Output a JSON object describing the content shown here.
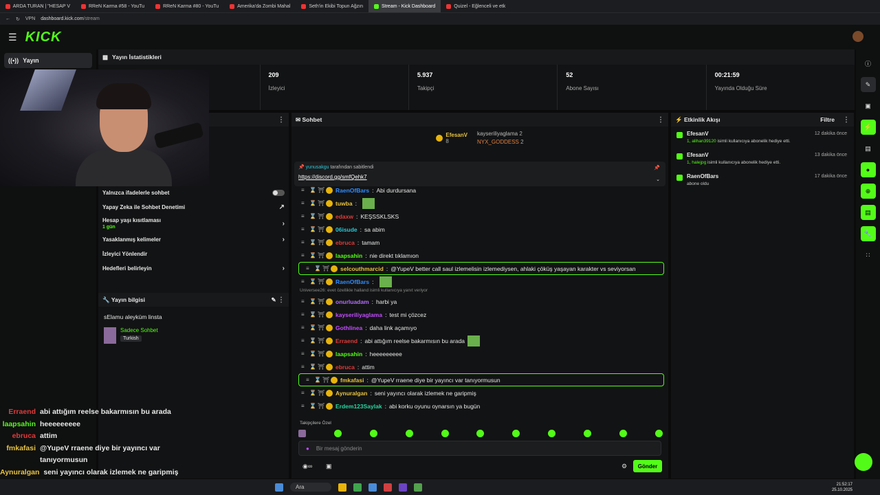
{
  "browser": {
    "tabs": [
      {
        "label": "ARDA TURAN | \"HESAP V"
      },
      {
        "label": "RReN Karma #58 - YouTu"
      },
      {
        "label": "RReN Karma #80 - YouTu"
      },
      {
        "label": "Amerika'da Zombi Mahal"
      },
      {
        "label": "Seth'in Ekibi Topun Ağzın"
      },
      {
        "label": "Stream - Kick Dashboard",
        "active": true
      },
      {
        "label": "Quizel - Eğlenceli ve etk"
      }
    ],
    "vpn": "VPN",
    "url_domain": "dashboard.kick.com",
    "url_path": "/stream"
  },
  "app": {
    "logo": "KICK"
  },
  "leftnav": {
    "items": [
      {
        "label": "Yayın"
      }
    ]
  },
  "stats": {
    "title": "Yayın İstatistikleri",
    "items": [
      {
        "value": "209",
        "label": "İzleyici"
      },
      {
        "value": "5.937",
        "label": "Takipçi"
      },
      {
        "value": "52",
        "label": "Abone Sayısı"
      },
      {
        "value": "00:21:59",
        "label": "Yayında Olduğu Süre"
      }
    ]
  },
  "settings": {
    "rows": [
      {
        "label": "Yalnızca ifadelerle sohbet",
        "control": "toggle"
      },
      {
        "label": "Yapay Zeka ile Sohbet Denetimi",
        "control": "link"
      },
      {
        "label": "Hesap yaşı kısıtlaması",
        "sub": "1 gün",
        "control": "chevron"
      },
      {
        "label": "Yasaklanmış kelimeler",
        "control": "chevron"
      },
      {
        "label": "İzleyici Yönlendir",
        "control": "none"
      },
      {
        "label": "Hedefleri belirleyin",
        "control": "chevron"
      }
    ]
  },
  "streaminfo": {
    "title": "Yayın bilgisi",
    "stream_title": "sElamu aleyküm linsta",
    "category": "Sadece Sohbet",
    "language": "Turkish"
  },
  "chat": {
    "title": "Sohbet",
    "leaderboard": {
      "first": {
        "name": "EfesanV",
        "count": "8"
      },
      "second": {
        "name": "kayseriliyaglama",
        "count": "2"
      },
      "third": {
        "name": "NYX_GODDESS",
        "count": "2"
      }
    },
    "pinned": {
      "by_user": "yunusakgu",
      "by_text": "tarafından sabitlendi",
      "link": "https://discord.gg/smfQehk7"
    },
    "messages": [
      {
        "user": "RaenOfBars",
        "text": "Abi durdursana",
        "color": "#2f8cff"
      },
      {
        "user": "tuwba",
        "text": "",
        "color": "#e8c340",
        "emote": true
      },
      {
        "user": "edaxw",
        "text": "KEŞSSKLSKS",
        "color": "#e03a3a"
      },
      {
        "user": "06isude",
        "text": "sa abim",
        "color": "#28c7d6"
      },
      {
        "user": "ebruca",
        "text": "tamam",
        "color": "#e03a3a"
      },
      {
        "user": "laapsahin",
        "text": "nie direkt tıklamıon",
        "color": "#53fc18"
      },
      {
        "user": "selcouthmarcid",
        "text": "@YupeV better call saul izlemelisin izlemediysen, ahlaki çöküş yaşayan karakter vs seviyorsan",
        "color": "#e8c340",
        "highlight": true
      },
      {
        "user": "RaenOfBars",
        "text": "",
        "color": "#2f8cff",
        "emote": true
      },
      {
        "user": "onurluadam",
        "text": "harbi ya",
        "color": "#b46cff",
        "reply": "Universee26: evet özellikle halland isimli kullanıcıya yanıt veriyor"
      },
      {
        "user": "kayseriliyaglama",
        "text": "test mi çözcez",
        "color": "#c24dff"
      },
      {
        "user": "Gothlinea",
        "text": "daha link açamıyo",
        "color": "#c24dff"
      },
      {
        "user": "Erraend",
        "text": "abi attığım reelse bakarmısın bu arada",
        "color": "#e03a3a",
        "emote": true
      },
      {
        "user": "laapsahin",
        "text": "heeeeeeeee",
        "color": "#53fc18"
      },
      {
        "user": "ebruca",
        "text": "attim",
        "color": "#e03a3a"
      },
      {
        "user": "fmkafasi",
        "text": "@YupeV rraene diye bir yayıncı var tanıyormusun",
        "color": "#e8c340",
        "highlight": true
      },
      {
        "user": "Aynuralgan",
        "text": "seni yayıncı olarak izlemek ne garipmiş",
        "color": "#e8c340"
      },
      {
        "user": "Erdem123Saylak",
        "text": "abi korku oyunu oynarsın ya bugün",
        "color": "#28d6a0"
      }
    ],
    "emote_label": "Takipçilere Özel",
    "input_placeholder": "Bir mesaj gönderin",
    "send_label": "Gönder"
  },
  "activity": {
    "title": "Etkinlik Akışı",
    "filter": "Filtre",
    "events": [
      {
        "user": "EfesanV",
        "desc_user": "1, alihan39120",
        "desc": "isimli kullanıcıya abonelik hediye etti.",
        "time": "12 dakika önce"
      },
      {
        "user": "EfesanV",
        "desc_user": "1, halejpg",
        "desc": "isimli kullanıcıya abonelik hediye etti.",
        "time": "13 dakika önce"
      },
      {
        "user": "RaenOfBars",
        "desc_user": "",
        "desc": "abone oldu",
        "time": "17 dakika önce"
      }
    ]
  },
  "overlay": {
    "lines": [
      {
        "user": "Erraend",
        "text": "abi attığım reelse bakarmısın bu arada",
        "color": "#e03a3a"
      },
      {
        "user": "laapsahin",
        "text": "heeeeeeeee",
        "color": "#53fc18"
      },
      {
        "user": "ebruca",
        "text": "attim",
        "color": "#e03a3a"
      },
      {
        "user": "fmkafasi",
        "text": "@YupeV rraene diye bir yayıncı var",
        "color": "#e8c340"
      },
      {
        "user": "",
        "text": "tanıyormusun",
        "color": "#e8c340"
      },
      {
        "user": "Aynuralgan",
        "text": "seni yayıncı olarak izlemek ne garipmiş",
        "color": "#e8c340"
      },
      {
        "user": "Erdem123Saylak",
        "text": "abi korku oyunu oynarsın ya bugün",
        "color": "#28d6a0"
      }
    ]
  },
  "taskbar": {
    "search": "Ara",
    "time": "21:52:17",
    "date": "25.10.2025"
  }
}
